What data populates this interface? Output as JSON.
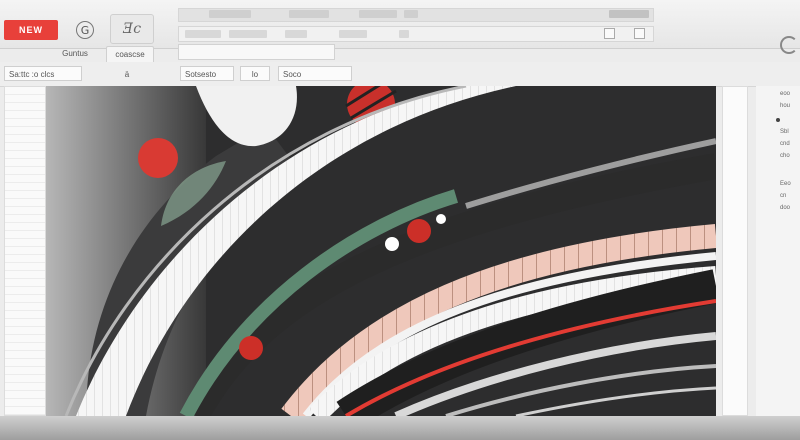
{
  "header": {
    "new_label": "NEW",
    "circle_icon_glyph": "G",
    "logo_text": "Ǝc",
    "tab_1": "Guntus",
    "tab_2": "coascse"
  },
  "toolbar": {
    "field_1": "Sa:ttc :o clcs",
    "field_2": "ä",
    "field_3": "Sotsesto",
    "field_4": "lo",
    "field_5": "Soco"
  },
  "properties": {
    "rows": [
      "eoo",
      "hou",
      "",
      "Sbl",
      "cnd",
      "cho",
      "",
      "Eeo",
      "cn",
      "doo"
    ]
  },
  "colors": {
    "accent_red": "#e8403a",
    "canvas_dark": "#2f2f30",
    "stripe_green": "#5e8a72",
    "stripe_peach": "#efc8bb"
  },
  "icons": {
    "new": "new-button",
    "circle_g": "circle-g-icon",
    "logo": "logo-icon",
    "corner": "refresh-icon"
  }
}
